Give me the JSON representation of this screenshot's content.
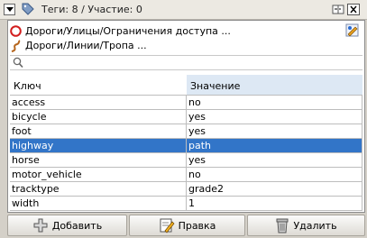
{
  "titlebar": {
    "title": "Теги: 8 / Участие: 0"
  },
  "presets": [
    {
      "label": "Дороги/Улицы/Ограничения доступа ...",
      "icon": "access-restriction-icon"
    },
    {
      "label": "Дороги/Линии/Тропа ...",
      "icon": "path-icon"
    }
  ],
  "search": {
    "placeholder": ""
  },
  "table": {
    "headers": {
      "key": "Ключ",
      "value": "Значение"
    },
    "rows": [
      {
        "key": "access",
        "value": "no"
      },
      {
        "key": "bicycle",
        "value": "yes"
      },
      {
        "key": "foot",
        "value": "yes"
      },
      {
        "key": "highway",
        "value": "path"
      },
      {
        "key": "horse",
        "value": "yes"
      },
      {
        "key": "motor_vehicle",
        "value": "no"
      },
      {
        "key": "tracktype",
        "value": "grade2"
      },
      {
        "key": "width",
        "value": "1"
      }
    ],
    "selected_row": "highway"
  },
  "buttons": {
    "add": "Добавить",
    "edit": "Правка",
    "delete": "Удалить"
  },
  "colors": {
    "selection": "#3275c8",
    "header_value_bg": "#dde8f4"
  }
}
